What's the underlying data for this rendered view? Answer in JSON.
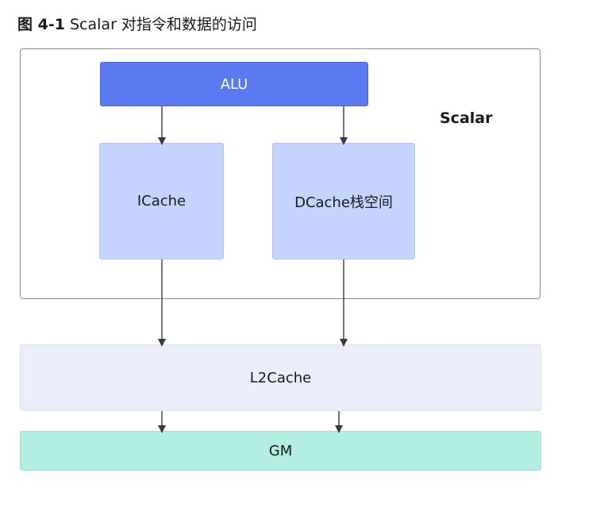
{
  "caption": {
    "number": "图 4-1",
    "text": "Scalar 对指令和数据的访问"
  },
  "scalar_label": "Scalar",
  "nodes": {
    "alu": "ALU",
    "icache": "ICache",
    "dcache": "DCache栈空间",
    "l2cache": "L2Cache",
    "gm": "GM"
  },
  "colors": {
    "alu": "#5b79f0",
    "cache": "#c4d4ff",
    "l2cache": "#eaedfa",
    "gm": "#b2efe2",
    "arrow": "#3a3a3a"
  }
}
